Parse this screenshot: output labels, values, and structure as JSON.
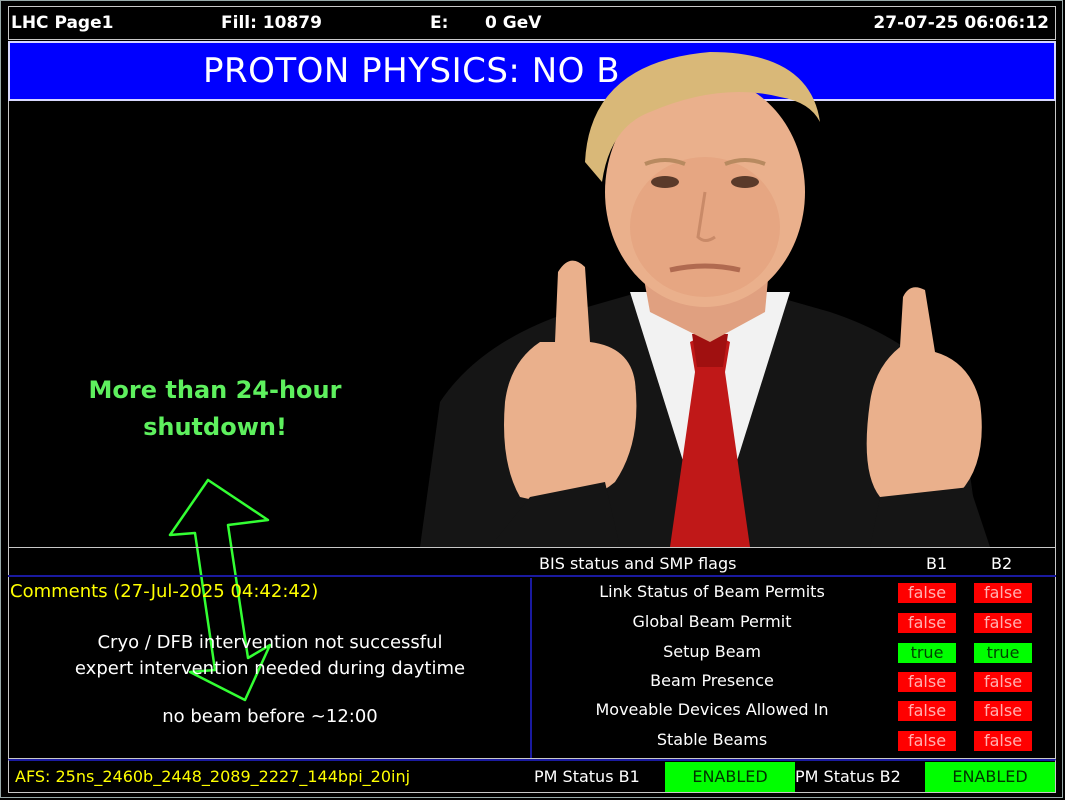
{
  "header": {
    "page": "LHC Page1",
    "fill": "Fill: 10879",
    "energy_label": "E:",
    "energy_value": "0 GeV",
    "datetime": "27-07-25 06:06:12"
  },
  "banner": {
    "title": "PROTON PHYSICS: NO B"
  },
  "overlay": {
    "line1": "More than 24-hour",
    "line2": "shutdown!"
  },
  "bis": {
    "title": "BIS status and SMP flags",
    "col_b1": "B1",
    "col_b2": "B2"
  },
  "comments": {
    "title": "Comments (27-Jul-2025 04:42:42)",
    "lines": [
      "Cryo / DFB intervention not successful",
      "expert intervention needed during daytime",
      "no beam before ~12:00"
    ]
  },
  "flags": [
    {
      "label": "Link Status of Beam Permits",
      "b1": "false",
      "b2": "false"
    },
    {
      "label": "Global Beam Permit",
      "b1": "false",
      "b2": "false"
    },
    {
      "label": "Setup Beam",
      "b1": "true",
      "b2": "true"
    },
    {
      "label": "Beam Presence",
      "b1": "false",
      "b2": "false"
    },
    {
      "label": "Moveable Devices Allowed In",
      "b1": "false",
      "b2": "false"
    },
    {
      "label": "Stable Beams",
      "b1": "false",
      "b2": "false"
    }
  ],
  "footer": {
    "afs": "AFS: 25ns_2460b_2448_2089_2227_144bpi_20inj",
    "pm_b1_label": "PM Status B1",
    "pm_b1_value": "ENABLED",
    "pm_b2_label": "PM Status B2",
    "pm_b2_value": "ENABLED"
  },
  "colors": {
    "banner_bg": "#0000ff",
    "flag_false": "#ff0000",
    "flag_true": "#00ff00",
    "comment_title": "#ffff00",
    "overlay_text": "#5ef05e"
  }
}
